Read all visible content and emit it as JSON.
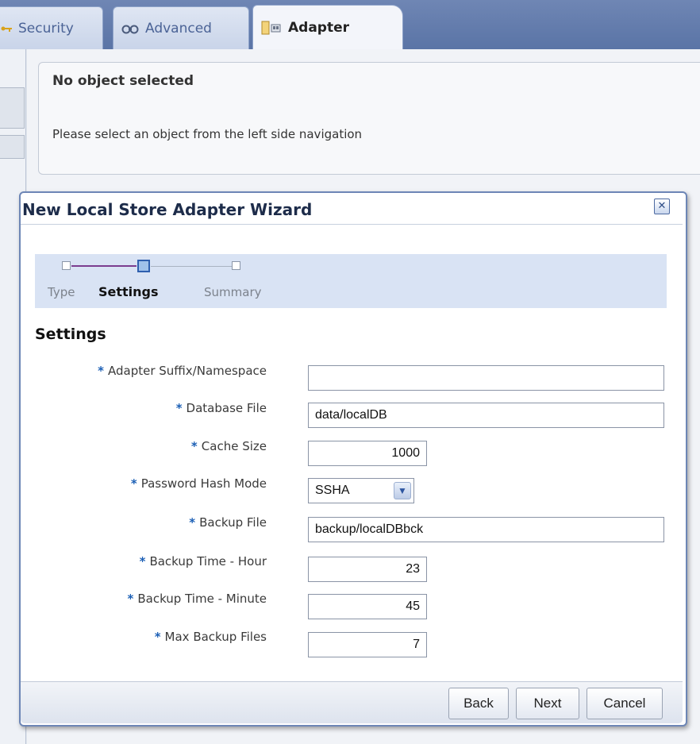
{
  "tabs": [
    {
      "label": "Security",
      "icon": "key-icon"
    },
    {
      "label": "Advanced",
      "icon": "binoculars-icon"
    },
    {
      "label": "Adapter",
      "icon": "adapter-icon"
    }
  ],
  "panel": {
    "title": "No object selected",
    "message": "Please select an object from the left side navigation"
  },
  "dialog": {
    "title": "New Local Store Adapter Wizard",
    "train": {
      "steps": [
        "Type",
        "Settings",
        "Summary"
      ],
      "current": "Settings"
    },
    "section_title": "Settings",
    "required_mark": "*",
    "fields": [
      {
        "label": "Adapter Suffix/Namespace",
        "value": ""
      },
      {
        "label": "Database File",
        "value": "data/localDB"
      },
      {
        "label": "Cache Size",
        "value": "1000"
      },
      {
        "label": "Password Hash Mode",
        "value": "SSHA"
      },
      {
        "label": "Backup File",
        "value": "backup/localDBbck"
      },
      {
        "label": "Backup Time - Hour",
        "value": "23"
      },
      {
        "label": "Backup Time - Minute",
        "value": "45"
      },
      {
        "label": "Max Backup Files",
        "value": "7"
      }
    ],
    "buttons": {
      "back": "Back",
      "next": "Next",
      "cancel": "Cancel"
    }
  },
  "colors": {
    "tabbar": "#5a74a6",
    "dialog_border": "#6d86b6",
    "train_bg": "#d9e3f4",
    "required": "#1b5fb5"
  }
}
